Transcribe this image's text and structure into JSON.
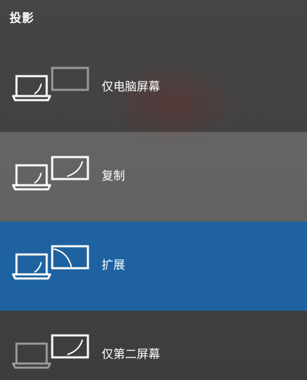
{
  "header": {
    "title": "投影"
  },
  "options": [
    {
      "label": "仅电脑屏幕",
      "icon": "pc-screen-only-icon"
    },
    {
      "label": "复制",
      "icon": "duplicate-icon"
    },
    {
      "label": "扩展",
      "icon": "extend-icon",
      "selected": true
    },
    {
      "label": "仅第二屏幕",
      "icon": "second-screen-only-icon"
    }
  ],
  "colors": {
    "panel_background": "#3f3f3f",
    "hover_background": "#6a6a6a",
    "selected_background": "#1e62a0",
    "text": "#ffffff",
    "inactive_icon": "#9a9a9a"
  }
}
